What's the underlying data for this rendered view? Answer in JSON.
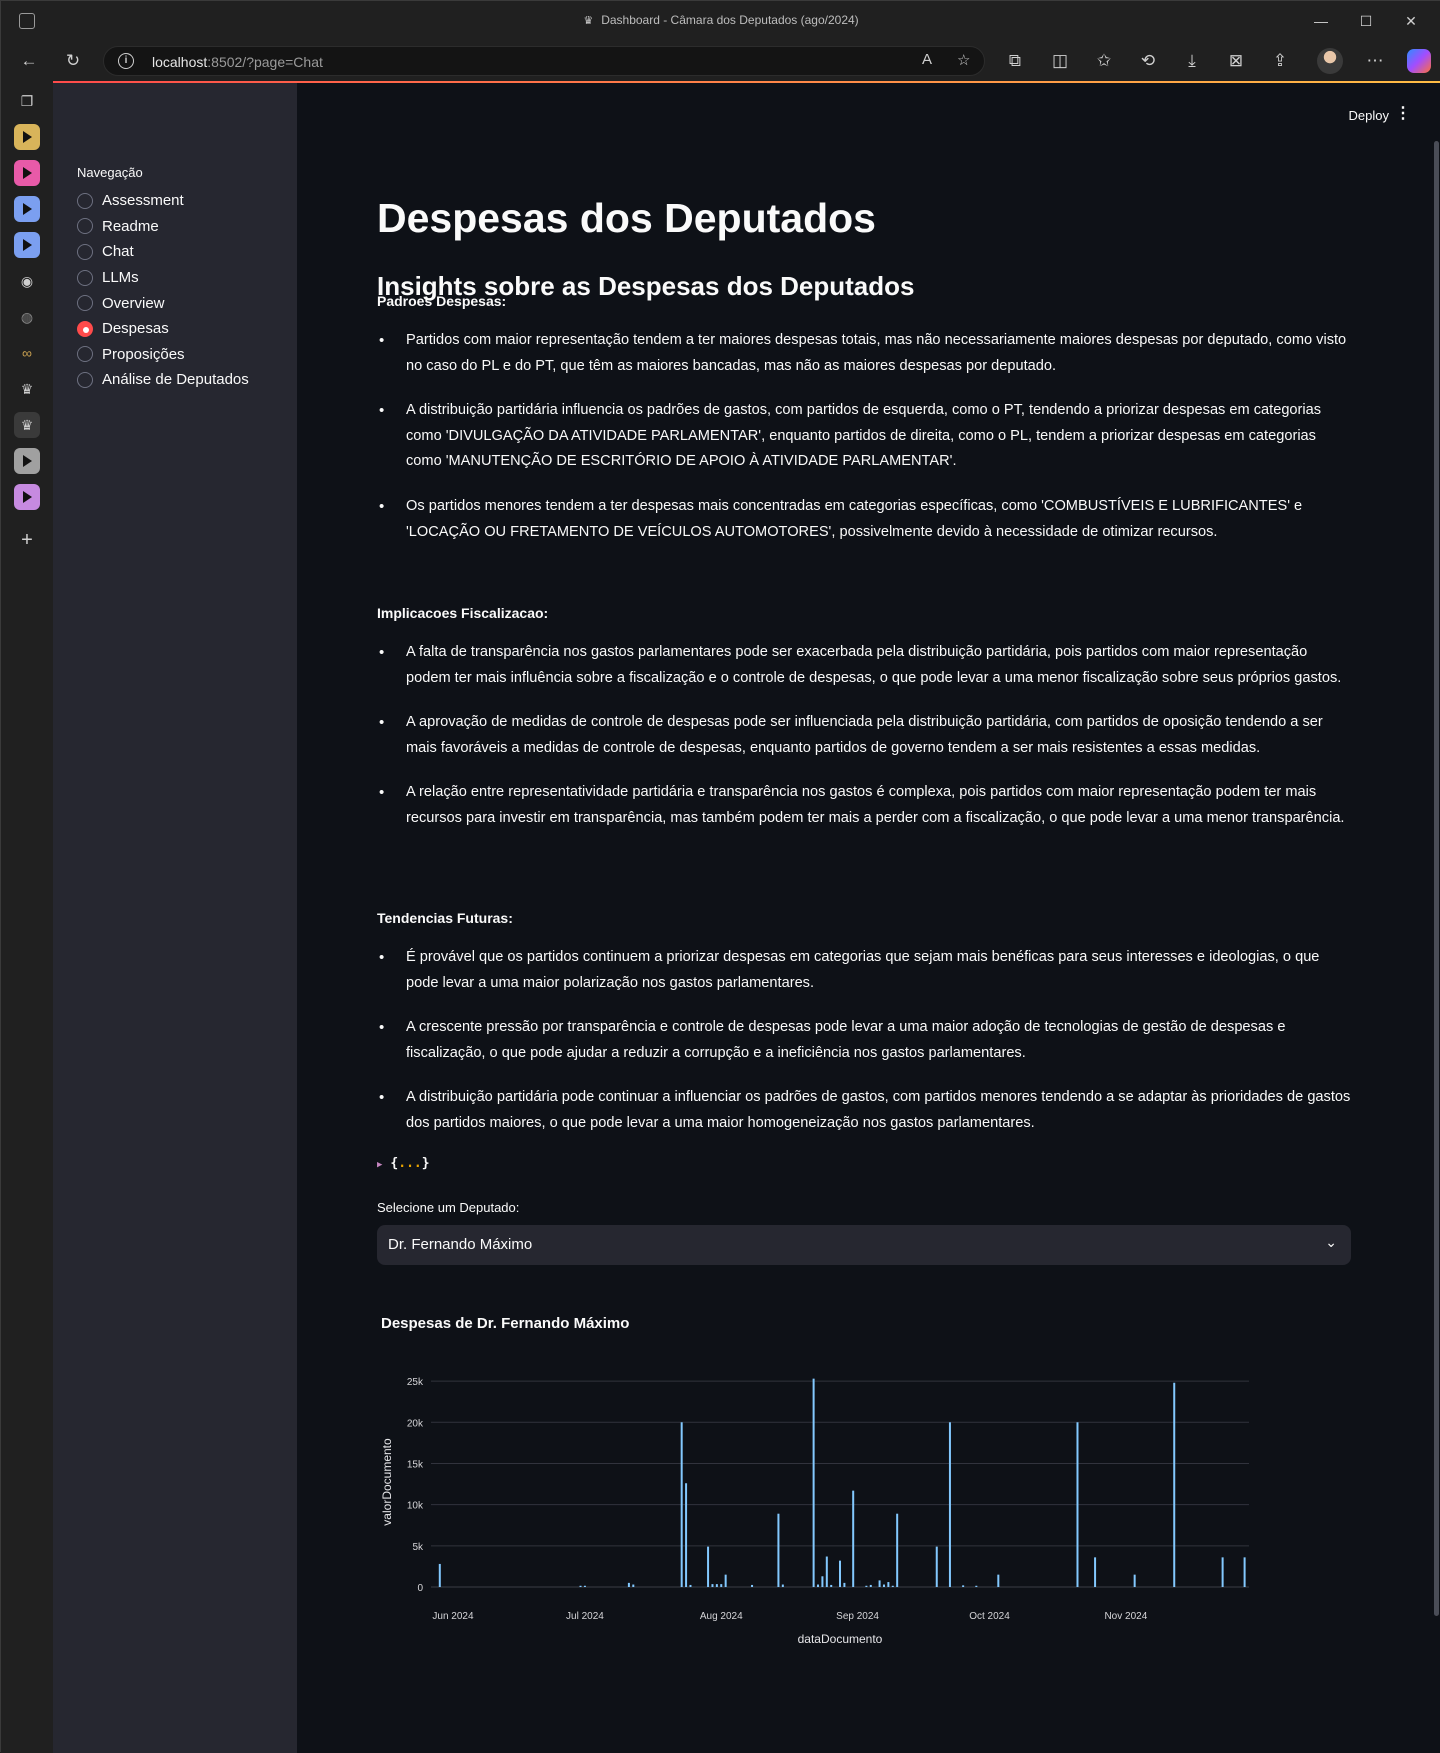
{
  "browser": {
    "window_title": "Dashboard - Câmara dos Deputados (ago/2024)",
    "url_host": "localhost",
    "url_rest": ":8502/?page=Chat"
  },
  "sidebar": {
    "title": "Navegação",
    "items": [
      {
        "label": "Assessment",
        "selected": false
      },
      {
        "label": "Readme",
        "selected": false
      },
      {
        "label": "Chat",
        "selected": false
      },
      {
        "label": "LLMs",
        "selected": false
      },
      {
        "label": "Overview",
        "selected": false
      },
      {
        "label": "Despesas",
        "selected": true
      },
      {
        "label": "Proposições",
        "selected": false
      },
      {
        "label": "Análise de Deputados",
        "selected": false
      }
    ]
  },
  "header": {
    "deploy_label": "Deploy"
  },
  "main": {
    "title": "Despesas dos Deputados",
    "subtitle": "Insights sobre as Despesas dos Deputados",
    "sections": [
      {
        "heading": "Padroes Despesas:",
        "bullets": [
          "Partidos com maior representação tendem a ter maiores despesas totais, mas não necessariamente maiores despesas por deputado, como visto no caso do PL e do PT, que têm as maiores bancadas, mas não as maiores despesas por deputado.",
          "A distribuição partidária influencia os padrões de gastos, com partidos de esquerda, como o PT, tendendo a priorizar despesas em categorias como 'DIVULGAÇÃO DA ATIVIDADE PARLAMENTAR', enquanto partidos de direita, como o PL, tendem a priorizar despesas em categorias como 'MANUTENÇÃO DE ESCRITÓRIO DE APOIO À ATIVIDADE PARLAMENTAR'.",
          "Os partidos menores tendem a ter despesas mais concentradas em categorias específicas, como 'COMBUSTÍVEIS E LUBRIFICANTES' e 'LOCAÇÃO OU FRETAMENTO DE VEÍCULOS AUTOMOTORES', possivelmente devido à necessidade de otimizar recursos."
        ]
      },
      {
        "heading": "Implicacoes Fiscalizacao:",
        "bullets": [
          "A falta de transparência nos gastos parlamentares pode ser exacerbada pela distribuição partidária, pois partidos com maior representação podem ter mais influência sobre a fiscalização e o controle de despesas, o que pode levar a uma menor fiscalização sobre seus próprios gastos.",
          "A aprovação de medidas de controle de despesas pode ser influenciada pela distribuição partidária, com partidos de oposição tendendo a ser mais favoráveis a medidas de controle de despesas, enquanto partidos de governo tendem a ser mais resistentes a essas medidas.",
          "A relação entre representatividade partidária e transparência nos gastos é complexa, pois partidos com maior representação podem ter mais recursos para investir em transparência, mas também podem ter mais a perder com a fiscalização, o que pode levar a uma menor transparência."
        ]
      },
      {
        "heading": "Tendencias Futuras:",
        "bullets": [
          "É provável que os partidos continuem a priorizar despesas em categorias que sejam mais benéficas para seus interesses e ideologias, o que pode levar a uma maior polarização nos gastos parlamentares.",
          "A crescente pressão por transparência e controle de despesas pode levar a uma maior adoção de tecnologias de gestão de despesas e fiscalização, o que pode ajudar a reduzir a corrupção e a ineficiência nos gastos parlamentares.",
          "A distribuição partidária pode continuar a influenciar os padrões de gastos, com partidos menores tendendo a se adaptar às prioridades de gastos dos partidos maiores, o que pode levar a uma maior homogeneização nos gastos parlamentares."
        ]
      }
    ],
    "json_open": "{",
    "json_dots": "...",
    "json_close": "}",
    "select_label": "Selecione um Deputado:",
    "select_value": "Dr. Fernando Máximo"
  },
  "colors": {
    "accent": "#ff4b4b",
    "bar": "#83c9ff",
    "bg": "#0e1117",
    "sidebar": "#262730"
  },
  "chart_data": {
    "type": "bar",
    "title": "Despesas de Dr. Fernando Máximo",
    "xlabel": "dataDocumento",
    "ylabel": "valorDocumento",
    "xlim": [
      "2024-05-27",
      "2024-11-29"
    ],
    "ylim": [
      0,
      25500
    ],
    "yticks": [
      0,
      5000,
      10000,
      15000,
      20000,
      25000
    ],
    "ytick_labels": [
      "0",
      "5k",
      "10k",
      "15k",
      "20k",
      "25k"
    ],
    "xticks": [
      "2024-06-01",
      "2024-07-01",
      "2024-08-01",
      "2024-09-01",
      "2024-10-01",
      "2024-11-01"
    ],
    "xtick_labels": [
      "Jun 2024",
      "Jul 2024",
      "Aug 2024",
      "Sep 2024",
      "Oct 2024",
      "Nov 2024"
    ],
    "x": [
      "2024-05-29",
      "2024-06-30",
      "2024-07-01",
      "2024-07-11",
      "2024-07-12",
      "2024-07-23",
      "2024-07-24",
      "2024-07-25",
      "2024-07-29",
      "2024-07-30",
      "2024-07-31",
      "2024-08-01",
      "2024-08-02",
      "2024-08-08",
      "2024-08-14",
      "2024-08-15",
      "2024-08-22",
      "2024-08-23",
      "2024-08-24",
      "2024-08-25",
      "2024-08-26",
      "2024-08-28",
      "2024-08-29",
      "2024-08-31",
      "2024-09-03",
      "2024-09-04",
      "2024-09-06",
      "2024-09-07",
      "2024-09-08",
      "2024-09-09",
      "2024-09-10",
      "2024-09-19",
      "2024-09-22",
      "2024-09-25",
      "2024-09-28",
      "2024-10-03",
      "-10-08",
      "2024-10-21",
      "2024-10-25",
      "2024-11-03",
      "2024-11-12",
      "2024-11-23",
      "2024-11-28"
    ],
    "values": [
      2800,
      150,
      150,
      500,
      300,
      20000,
      12600,
      250,
      4900,
      350,
      350,
      350,
      1500,
      250,
      8900,
      300,
      25300,
      300,
      1300,
      3700,
      250,
      3200,
      500,
      11700,
      150,
      250,
      800,
      300,
      600,
      150,
      8900,
      4900,
      20000,
      200,
      150,
      1500,
      4900,
      20000,
      3600,
      1500,
      24800,
      3600,
      3600
    ]
  }
}
